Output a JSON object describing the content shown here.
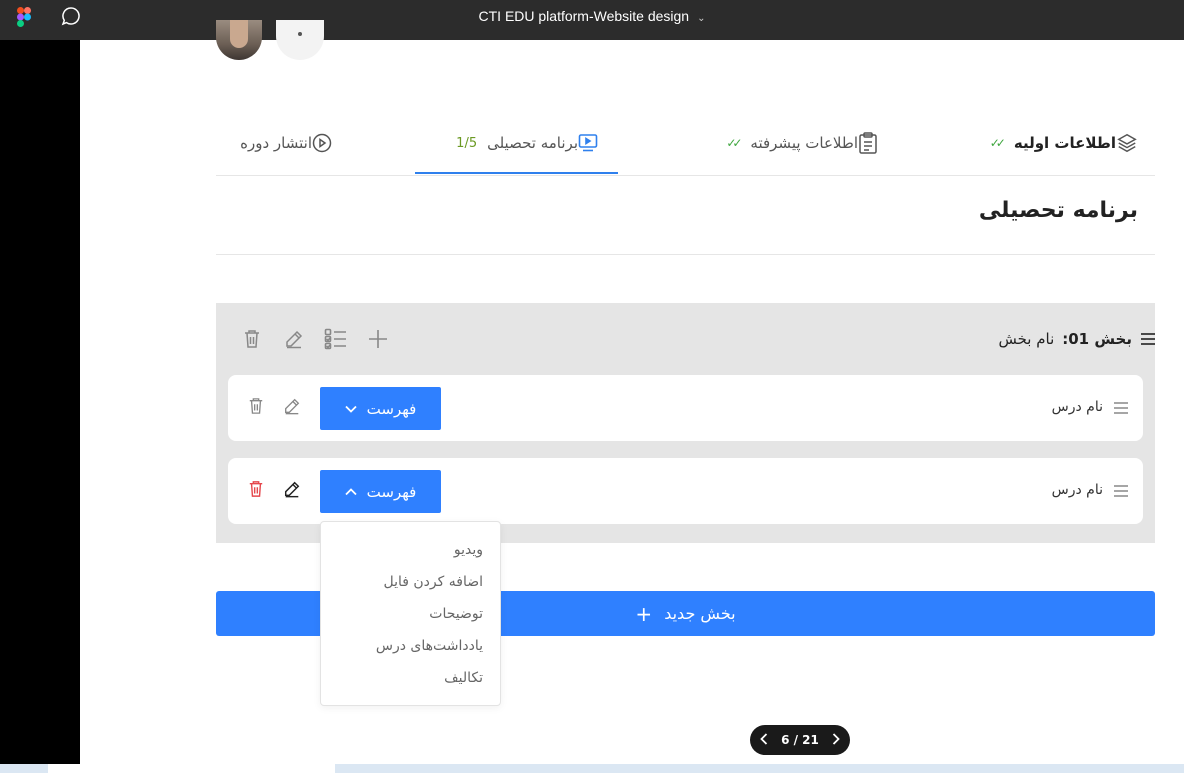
{
  "app": {
    "title": "CTI EDU platform-Website design"
  },
  "tabs": [
    {
      "label": "اطلاعات اولیه",
      "status": "✓✓",
      "icon": "layers-icon"
    },
    {
      "label": "اطلاعات پیشرفته",
      "status": "✓✓",
      "icon": "clipboard-icon"
    },
    {
      "label": "برنامه تحصیلی",
      "status": "1/5",
      "icon": "video-screen-icon"
    },
    {
      "label": "انتشار دوره",
      "icon": "play-circle-icon"
    }
  ],
  "active_tab_index": 2,
  "page_title": "برنامه تحصیلی",
  "section": {
    "label": "بخش 01:",
    "name": "نام بخش"
  },
  "lessons": [
    {
      "name": "نام درس",
      "button_label": "فهرست",
      "expanded": false
    },
    {
      "name": "نام درس",
      "button_label": "فهرست",
      "expanded": true
    }
  ],
  "dropdown_items": [
    "ویدیو",
    "اضافه کردن فایل",
    "توضیحات",
    "یادداشت‌های درس",
    "تکالیف"
  ],
  "new_section_label": "بخش جدید",
  "pager": {
    "label": "6 / 21"
  },
  "colors": {
    "accent": "#2f80ff",
    "check": "#3fa63f",
    "progress": "#6b9a23",
    "danger": "#e5484d"
  }
}
